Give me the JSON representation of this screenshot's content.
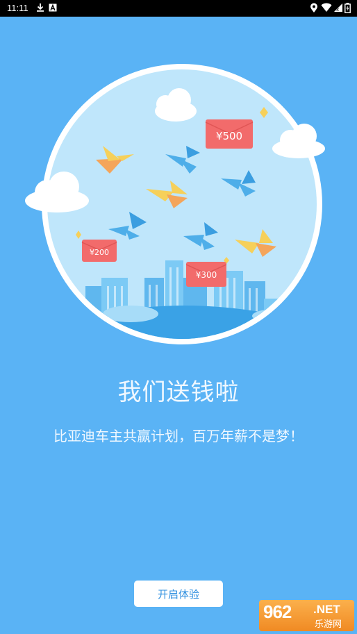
{
  "status_bar": {
    "time": "11:11",
    "left_icons": [
      "download-icon",
      "a-notification-icon"
    ],
    "right_icons": [
      "location-icon",
      "wifi-icon",
      "signal-icon",
      "battery-icon"
    ]
  },
  "illustration": {
    "red_envelopes": [
      {
        "label": "¥500"
      },
      {
        "label": "¥200"
      },
      {
        "label": "¥300"
      }
    ]
  },
  "headline": "我们送钱啦",
  "subtitle": "比亚迪车主共赢计划，百万年薪不是梦！",
  "cta": {
    "label": "开启体验"
  },
  "watermark": {
    "logo": "962",
    "net": ".NET",
    "site": "乐游网"
  },
  "colors": {
    "background": "#5ab3f5",
    "button_text": "#2f8fdf",
    "envelope": "#f26b6b"
  }
}
